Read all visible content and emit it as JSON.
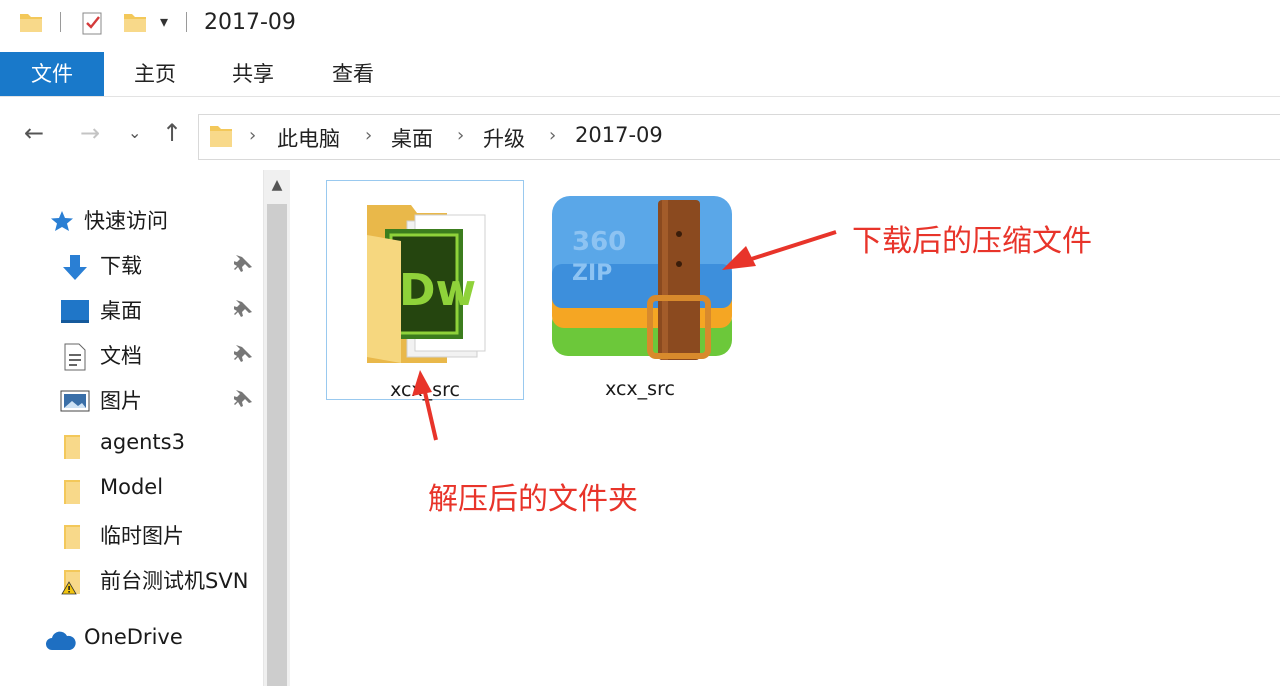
{
  "window": {
    "title": "2017-09"
  },
  "ribbon": {
    "tabs": [
      "文件",
      "主页",
      "共享",
      "查看"
    ]
  },
  "address": {
    "crumbs": [
      "此电脑",
      "桌面",
      "升级",
      "2017-09"
    ]
  },
  "navpane": {
    "quick_access": "快速访问",
    "items": [
      {
        "label": "下载",
        "icon": "download-arrow-icon",
        "pinned": true
      },
      {
        "label": "桌面",
        "icon": "desktop-icon",
        "pinned": true
      },
      {
        "label": "文档",
        "icon": "document-icon",
        "pinned": true
      },
      {
        "label": "图片",
        "icon": "pictures-icon",
        "pinned": true
      },
      {
        "label": "agents3",
        "icon": "folder-icon",
        "pinned": false
      },
      {
        "label": "Model",
        "icon": "folder-icon",
        "pinned": false
      },
      {
        "label": "临时图片",
        "icon": "folder-icon",
        "pinned": false
      },
      {
        "label": "前台测试机SVN",
        "icon": "warning-folder-icon",
        "pinned": false
      }
    ],
    "onedrive": "OneDrive"
  },
  "files": [
    {
      "name": "xcx_src",
      "type": "folder",
      "selected": true
    },
    {
      "name": "xcx_src",
      "type": "360zip"
    }
  ],
  "annotations": {
    "zip_note": "下载后的压缩文件",
    "folder_note": "解压后的文件夹"
  },
  "colors": {
    "accent": "#1979ca",
    "annotation": "#e8342a",
    "folder": "#f7d57a"
  }
}
